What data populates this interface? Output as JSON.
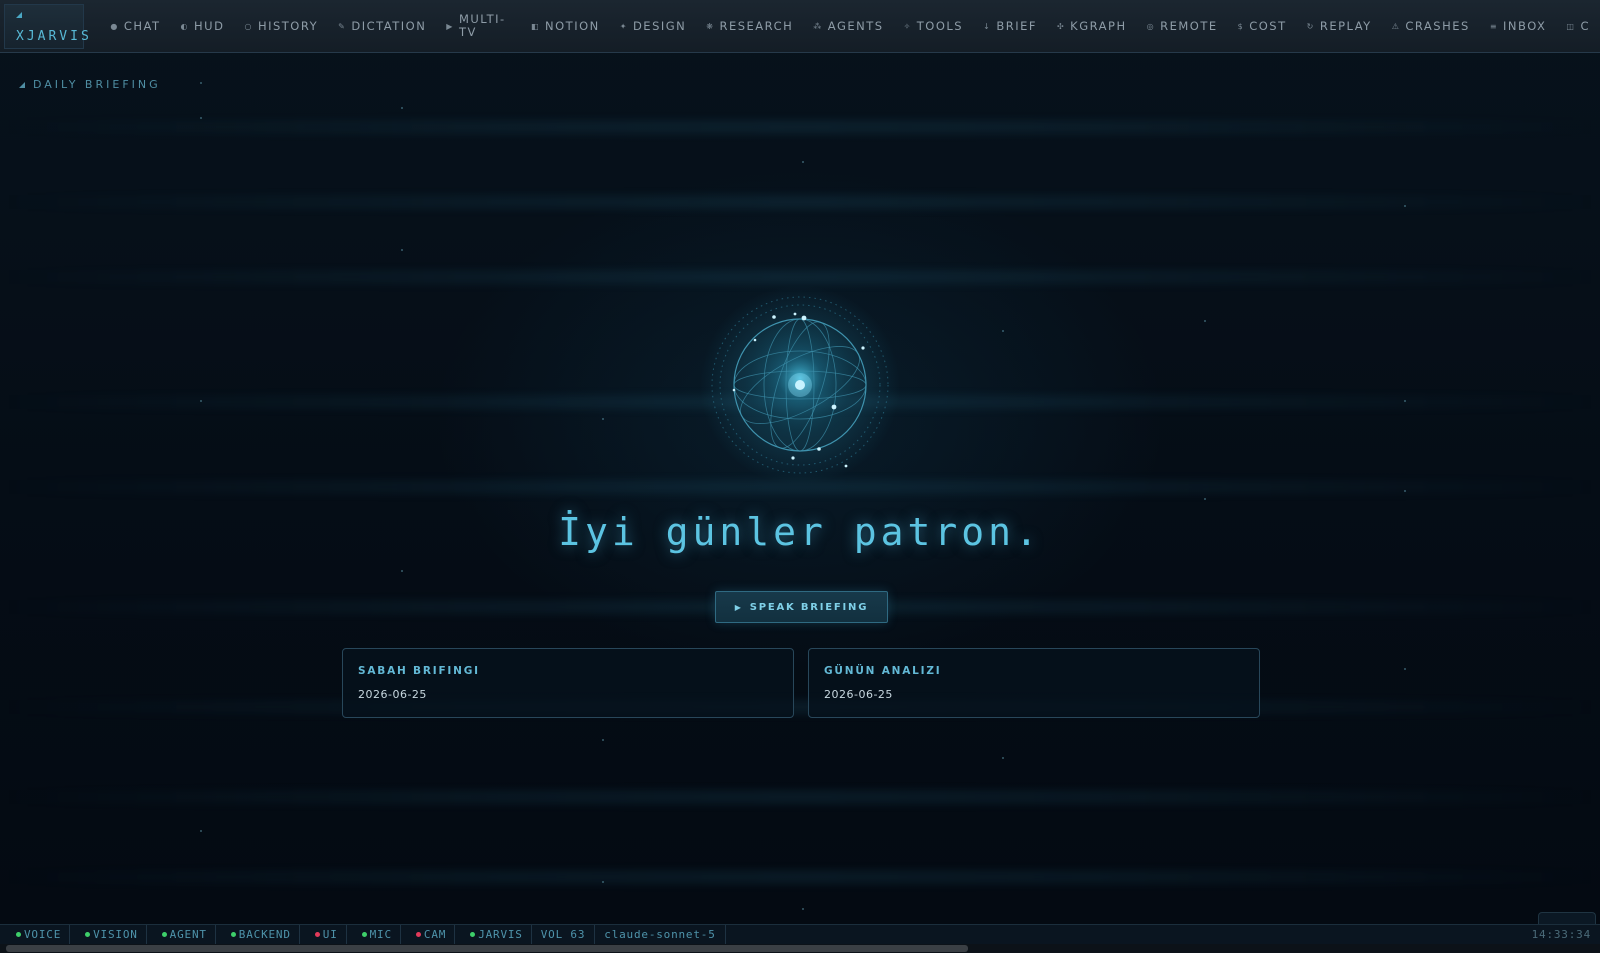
{
  "app": {
    "brand": "XJARVIS"
  },
  "nav": [
    {
      "icon": "chat-dot-icon",
      "glyph": "●",
      "label": "CHAT"
    },
    {
      "icon": "hud-icon",
      "glyph": "◐",
      "label": "HUD"
    },
    {
      "icon": "history-icon",
      "glyph": "○",
      "label": "HISTORY"
    },
    {
      "icon": "dictation-icon",
      "glyph": "✎",
      "label": "DICTATION"
    },
    {
      "icon": "play-icon",
      "glyph": "▶",
      "label": "MULTI-TV"
    },
    {
      "icon": "notion-icon",
      "glyph": "◧",
      "label": "NOTION"
    },
    {
      "icon": "design-icon",
      "glyph": "✦",
      "label": "DESIGN"
    },
    {
      "icon": "research-icon",
      "glyph": "❋",
      "label": "RESEARCH"
    },
    {
      "icon": "agents-icon",
      "glyph": "⁂",
      "label": "AGENTS"
    },
    {
      "icon": "tools-icon",
      "glyph": "✧",
      "label": "TOOLS"
    },
    {
      "icon": "brief-icon",
      "glyph": "↓",
      "label": "BRIEF"
    },
    {
      "icon": "kgraph-icon",
      "glyph": "✣",
      "label": "KGRAPH"
    },
    {
      "icon": "remote-icon",
      "glyph": "◎",
      "label": "REMOTE"
    },
    {
      "icon": "cost-icon",
      "glyph": "$",
      "label": "COST"
    },
    {
      "icon": "replay-icon",
      "glyph": "↻",
      "label": "REPLAY"
    },
    {
      "icon": "crashes-icon",
      "glyph": "⚠",
      "label": "CRASHES"
    },
    {
      "icon": "inbox-icon",
      "glyph": "≡",
      "label": "INBOX"
    },
    {
      "icon": "overflow-icon",
      "glyph": "◫",
      "label": "C"
    }
  ],
  "section": {
    "label": "DAILY BRIEFING"
  },
  "greeting": "İyi günler patron.",
  "speak_button": {
    "label": "SPEAK BRIEFING",
    "glyph": "▶"
  },
  "cards": [
    {
      "title": "SABAH BRIFINGI",
      "date": "2026-06-25"
    },
    {
      "title": "GÜNÜN ANALIZI",
      "date": "2026-06-25"
    }
  ],
  "status": {
    "indicators": [
      {
        "label": "VOICE",
        "color": "#3ecf6a"
      },
      {
        "label": "VISION",
        "color": "#3ecf6a"
      },
      {
        "label": "AGENT",
        "color": "#3ecf6a"
      },
      {
        "label": "BACKEND",
        "color": "#3ecf6a"
      },
      {
        "label": "UI",
        "color": "#e23a5a"
      },
      {
        "label": "MIC",
        "color": "#3ecf6a"
      },
      {
        "label": "CAM",
        "color": "#e23a5a"
      },
      {
        "label": "JARVIS",
        "color": "#3ecf6a"
      }
    ],
    "volume": "VOL 63",
    "model": "claude-sonnet-5",
    "clock": "14:33:34"
  },
  "colors": {
    "accent": "#5cc4e2",
    "background": "#050c14",
    "ok": "#3ecf6a",
    "error": "#e23a5a"
  }
}
